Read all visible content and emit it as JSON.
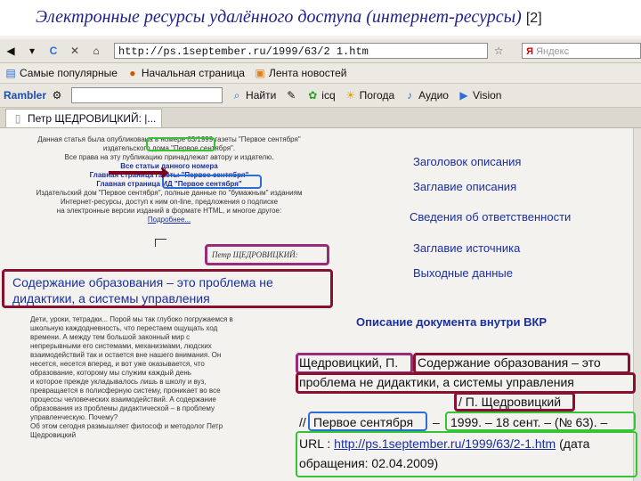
{
  "slide": {
    "title": "Электронные ресурсы удалённого доступа (интернет-ресурсы)",
    "title_note": "[2]"
  },
  "browser": {
    "url": "http://ps.1september.ru/1999/63/2 1.htm",
    "search_engine": "Яндекс",
    "bookmarks": [
      "Самые популярные",
      "Начальная страница",
      "Лента новостей"
    ],
    "rambler_toolbar": {
      "brand": "Rambler",
      "find_label": "Найти",
      "weather_label": "Погода",
      "audio_label": "Аудио",
      "vision_label": "Vision",
      "icq_label": "icq"
    },
    "tab_title": "Петр ЩЕДРОВИЦКИЙ: |..."
  },
  "page": {
    "header_lines": [
      "Данная статья была опубликована в номере 63/1999 газеты \"Первое сентября\"",
      "издательского дома \"Первое сентября\".",
      "Все права на эту публикацию принадлежат автору и издателю.",
      "Все статьи данного номера",
      "Главная страница газеты \"Первое сентября\"",
      "Главная страница ИД \"Первое сентября\"",
      "Издательский дом \"Первое сентября\", полные данные по \"бумажным\" изданиям",
      "Интернет-ресурсы, доступ к ним on-line, предложения о подписке",
      "на электронные версии изданий в формате HTML, и многое другое:",
      "Подробнее..."
    ],
    "author_heading": "Петр ЩЕДРОВИЦКИЙ:",
    "article_title": "Содержание образования – это проблема не дидактики, а системы управления",
    "body_text": "Дети, уроки, тетрадки... Порой мы так глубоко погружаемся в\nшкольную каждодневность, что перестаем ощущать ход\nвремени. А между тем большой законный мир с\nнепрерывными его системами, механизмами, людских\nвзаимодействий так и остается вне нашего внимания. Он\nнесется, несется вперед, и вот уже оказывается, что\nобразование, которому мы служим каждый день\nи которое прежде укладывалось лишь в школу и вуз,\nпревращается в полисферную систему, проникает во все\nпроцессы человеческих взаимодействий. А содержание\nобразования из проблемы дидактической – в проблему\nуправленческую. Почему?\nОб этом сегодня размышляет философ и методолог Петр\nЩедровицкий"
  },
  "annotations": {
    "heading_label": "Заголовок описания",
    "title_label": "Заглавие описания",
    "responsibility_label": "Сведения об ответственности",
    "source_title_label": "Заглавие источника",
    "output_label": "Выходные данные",
    "in_vkr_label": "Описание документа внутри ВКР"
  },
  "example": {
    "author": "Щедровицкий, П.",
    "title_part1": "Содержание образования – это",
    "title_part2": "проблема не дидактики, а системы управления",
    "responsibility": "/ П. Щедровицкий",
    "source_prefix": "//",
    "source": "Первое сентября",
    "sep": "–",
    "year": "1999. – 18 сент. – (№ 63). –",
    "url_prefix": "URL :",
    "url": "http://ps.1september.ru/1999/63/2-1.htm",
    "access_suffix": "(дата",
    "access": "обращения: 02.04.2009)"
  },
  "colors": {
    "green": "#35c435",
    "blue": "#2a6fd6",
    "purple": "#9a2a7a",
    "crimson": "#8a1030",
    "annotation_text": "#1a2fa0"
  }
}
